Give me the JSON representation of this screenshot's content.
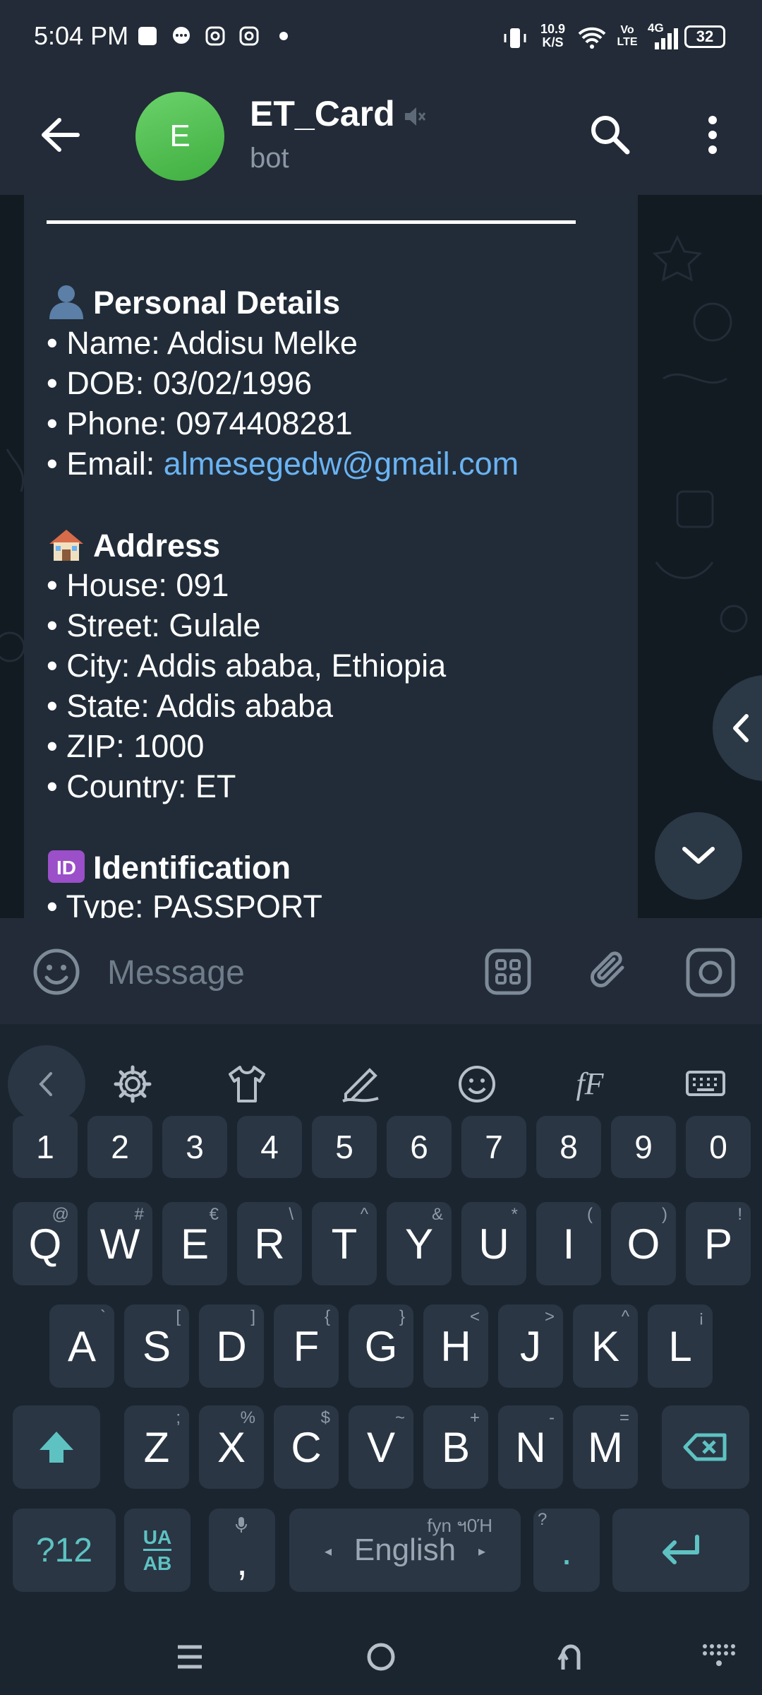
{
  "status_bar": {
    "time": "5:04 PM",
    "net_speed_value": "10.9",
    "net_speed_unit": "K/S",
    "volte": "Vo LTE",
    "network": "4G",
    "battery": "32"
  },
  "header": {
    "avatar_letter": "E",
    "title": "ET_Card",
    "subtitle": "bot",
    "icons": [
      "back-arrow-icon",
      "mute-icon",
      "search-icon",
      "more-vert-icon"
    ]
  },
  "message": {
    "personal_heading": "Personal Details",
    "name": "• Name: Addisu Melke",
    "dob": "• DOB: 03/02/1996",
    "phone": "• Phone: 0974408281",
    "email_label": "• Email: ",
    "email": "almesegedw@gmail.com",
    "address_heading": "Address",
    "house": "• House: 091",
    "street": "• Street: Gulale",
    "city": "• City: Addis ababa, Ethiopia",
    "state": "• State: Addis ababa",
    "zip": "• ZIP: 1000",
    "country": "• Country: ET",
    "id_heading": "Identification",
    "id_type": "• Type: PASSPORT"
  },
  "input": {
    "placeholder": "Message"
  },
  "keyboard": {
    "numbers": [
      "1",
      "2",
      "3",
      "4",
      "5",
      "6",
      "7",
      "8",
      "9",
      "0"
    ],
    "row1": [
      {
        "k": "Q",
        "s": "@"
      },
      {
        "k": "W",
        "s": "#"
      },
      {
        "k": "E",
        "s": "€"
      },
      {
        "k": "R",
        "s": "\\"
      },
      {
        "k": "T",
        "s": "^"
      },
      {
        "k": "Y",
        "s": "&"
      },
      {
        "k": "U",
        "s": "*"
      },
      {
        "k": "I",
        "s": "("
      },
      {
        "k": "O",
        "s": ")"
      },
      {
        "k": "P",
        "s": "!"
      }
    ],
    "row2": [
      {
        "k": "A",
        "s": "`"
      },
      {
        "k": "S",
        "s": "["
      },
      {
        "k": "D",
        "s": "]"
      },
      {
        "k": "F",
        "s": "{"
      },
      {
        "k": "G",
        "s": "}"
      },
      {
        "k": "H",
        "s": "<"
      },
      {
        "k": "J",
        "s": ">"
      },
      {
        "k": "K",
        "s": "^"
      },
      {
        "k": "L",
        "s": "¡"
      }
    ],
    "row3": [
      {
        "k": "Z",
        "s": ";"
      },
      {
        "k": "X",
        "s": "%"
      },
      {
        "k": "C",
        "s": "$"
      },
      {
        "k": "V",
        "s": "~"
      },
      {
        "k": "B",
        "s": "+"
      },
      {
        "k": "N",
        "s": "-"
      },
      {
        "k": "M",
        "s": "="
      }
    ],
    "sym_key": "?12",
    "lang_key_top": "UA",
    "lang_key_bottom": "AB",
    "comma": ",",
    "space_label": "English",
    "space_hint": "fyn ฯ0Ή",
    "period": ".",
    "period_hint": "?"
  },
  "colors": {
    "accent": "#6ab3f3",
    "avatar": "#4cbb4c",
    "keyboard_teal": "#5ec2c2"
  }
}
